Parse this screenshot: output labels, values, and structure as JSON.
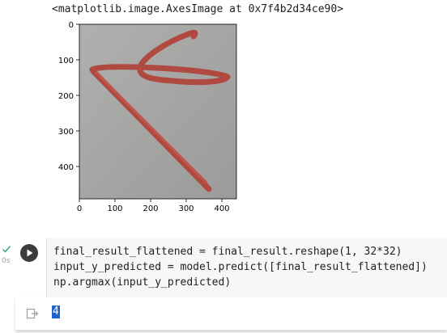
{
  "output_repr": "<matplotlib.image.AxesImage at 0x7f4b2d34ce90>",
  "plot": {
    "x_ticks": [
      "0",
      "100",
      "200",
      "300",
      "400"
    ],
    "y_ticks": [
      "0",
      "100",
      "200",
      "300",
      "400"
    ],
    "image_background": "#a7a7a5",
    "stroke_color": "#b04a41"
  },
  "cell": {
    "exec_time": "0s",
    "code_lines": [
      "final_result_flattened = final_result.reshape(1, 32*32)",
      "input_y_predicted = model.predict([final_result_flattened])",
      "np.argmax(input_y_predicted)"
    ],
    "status_color": "#21a366",
    "run_icon": "play-icon"
  },
  "output": {
    "value": "4",
    "icon": "output-redirect-icon"
  }
}
